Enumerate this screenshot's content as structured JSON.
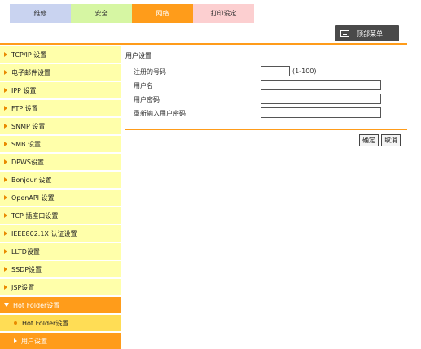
{
  "tabs": [
    "维修",
    "安全",
    "网络",
    "打印设定"
  ],
  "active_tab": "网络",
  "top_menu": {
    "label": "顶部菜单"
  },
  "sidebar": {
    "items": [
      "TCP/IP 设置",
      "电子邮件设置",
      "IPP 设置",
      "FTP 设置",
      "SNMP 设置",
      "SMB 设置",
      "DPWS设置",
      "Bonjour 设置",
      "OpenAPI 设置",
      "TCP 插座口设置",
      "IEEE802.1X 认证设置",
      "LLTD设置",
      "SSDP设置",
      "JSP设置"
    ],
    "open_group": "Hot Folder设置",
    "sub_items": [
      "Hot Folder设置",
      "用户设置"
    ]
  },
  "form": {
    "title": "用户设置",
    "fields": [
      {
        "label": "注册的号码",
        "value": "",
        "range": "(1-100)"
      },
      {
        "label": "用户名",
        "value": ""
      },
      {
        "label": "用户密码",
        "value": ""
      },
      {
        "label": "重新输入用户密码",
        "value": ""
      }
    ]
  },
  "buttons": {
    "ok": "确定",
    "cancel": "取消"
  },
  "colors": {
    "accent": "#ff9c1a",
    "sidebar_bg": "#ffffaa",
    "sub_active_bg": "#ffdd55"
  }
}
